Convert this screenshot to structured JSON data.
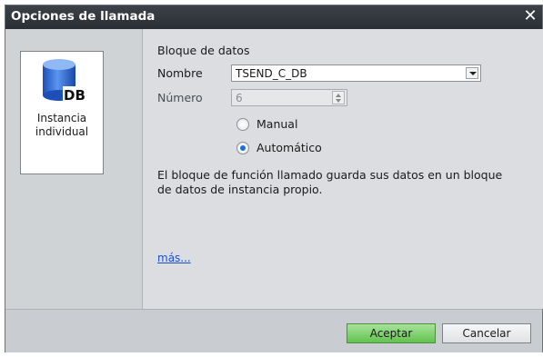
{
  "dialog": {
    "title": "Opciones de llamada",
    "close_glyph": "✕"
  },
  "left_panel": {
    "option": {
      "icon": "db-cylinder-icon",
      "icon_text": "DB",
      "line1": "Instancia",
      "line2": "individual"
    }
  },
  "content": {
    "section_title": "Bloque de datos",
    "name_label": "Nombre",
    "name_value": "TSEND_C_DB",
    "number_label": "Número",
    "number_value": "6",
    "radio_manual_label": "Manual",
    "radio_auto_label": "Automático",
    "selected_radio": "Automático",
    "description_line1": "El bloque de función llamado guarda sus datos en un bloque",
    "description_line2": "de datos de instancia propio.",
    "more_link": "más..."
  },
  "footer": {
    "ok_label": "Aceptar",
    "cancel_label": "Cancelar"
  },
  "colors": {
    "accent": "#1f6fd1",
    "ok_button": "#62c24f",
    "titlebar": "#2b2f35"
  }
}
